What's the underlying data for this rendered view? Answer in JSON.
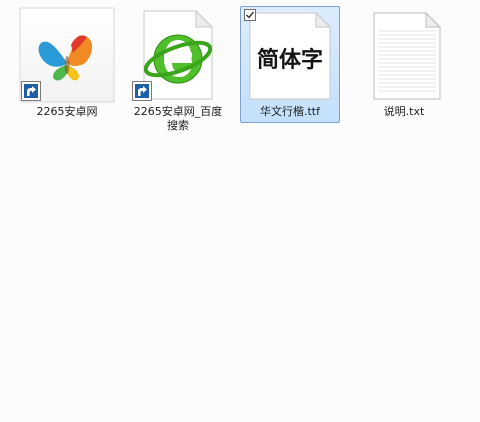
{
  "items": [
    {
      "label": "2265安卓网",
      "icon": "butterfly-icon",
      "shortcut": true,
      "selected": false
    },
    {
      "label": "2265安卓网_百度搜索",
      "icon": "ie-browser-icon",
      "shortcut": true,
      "selected": false
    },
    {
      "label": "华文行楷.ttf",
      "icon": "font-file-icon",
      "shortcut": false,
      "selected": true,
      "preview": "简体字"
    },
    {
      "label": "说明.txt",
      "icon": "text-file-icon",
      "shortcut": false,
      "selected": false
    }
  ],
  "colors": {
    "background": "#fcfcfc",
    "selection": "#c4e0fb",
    "selection_border": "#7da2ce",
    "shortcut_arrow_bg": "#1f5fa8"
  }
}
